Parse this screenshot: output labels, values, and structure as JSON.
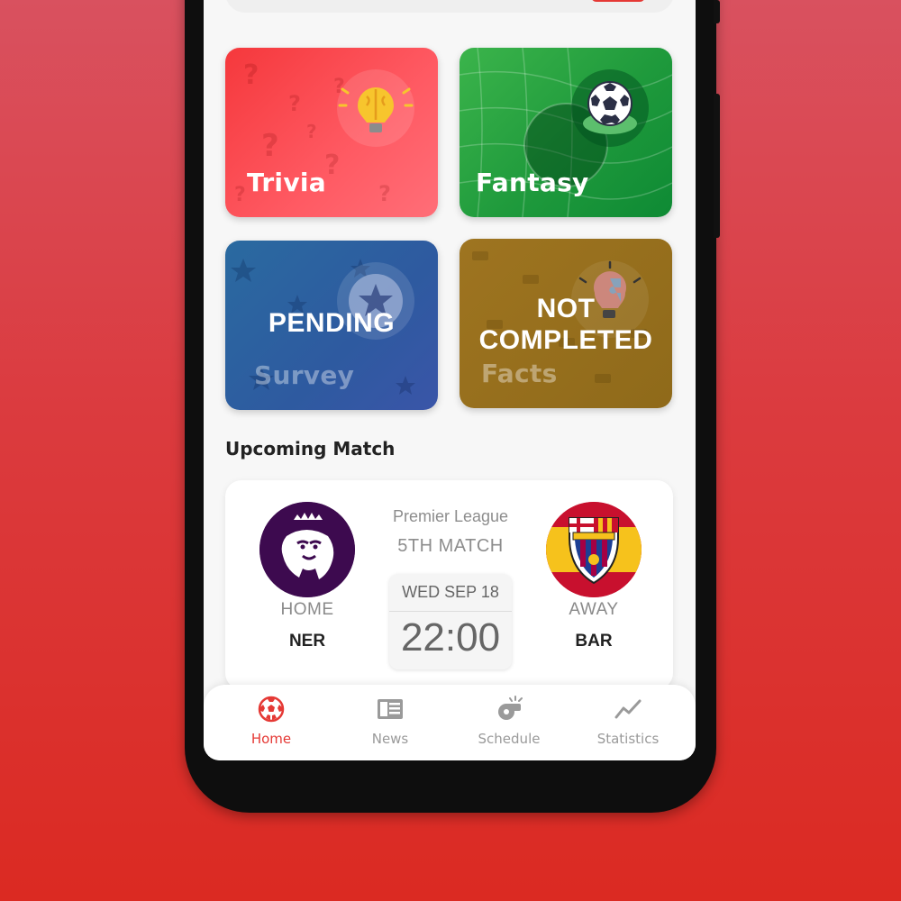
{
  "colors": {
    "accent": "#e53935",
    "background_top": "#d9515f",
    "background_bottom": "#db2a22"
  },
  "cards": [
    {
      "id": "trivia",
      "label": "Trivia",
      "icon": "brain-bulb-icon",
      "status": ""
    },
    {
      "id": "fantasy",
      "label": "Fantasy",
      "icon": "soccer-ball-icon",
      "status": ""
    },
    {
      "id": "survey",
      "label": "Survey",
      "icon": "star-icon",
      "status": "PENDING"
    },
    {
      "id": "facts",
      "label": "Facts",
      "icon": "puzzle-bulb-icon",
      "status_line1": "NOT",
      "status_line2": "COMPLETED"
    }
  ],
  "upcoming": {
    "title": "Upcoming Match",
    "league": "Premier League",
    "match_number": "5TH MATCH",
    "date": "WED SEP 18",
    "time": "22:00",
    "home": {
      "label": "HOME",
      "code": "NER",
      "crest": "premier-league-lion-crest"
    },
    "away": {
      "label": "AWAY",
      "code": "BAR",
      "crest": "fc-barcelona-crest"
    }
  },
  "nav": [
    {
      "label": "Home",
      "icon": "soccer-ball-icon",
      "active": true
    },
    {
      "label": "News",
      "icon": "newspaper-icon",
      "active": false
    },
    {
      "label": "Schedule",
      "icon": "whistle-icon",
      "active": false
    },
    {
      "label": "Statistics",
      "icon": "trend-line-icon",
      "active": false
    }
  ]
}
